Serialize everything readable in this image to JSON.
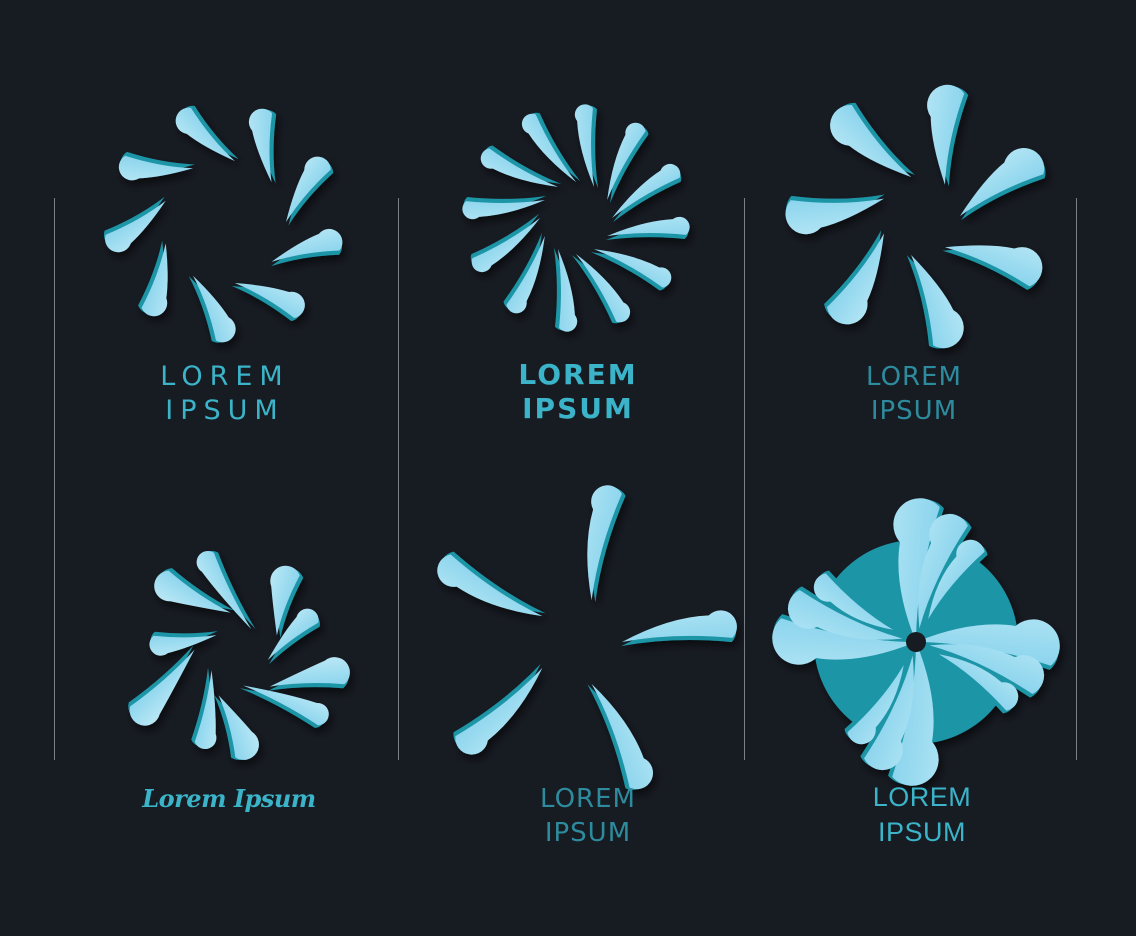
{
  "colors": {
    "background": "#171b22",
    "caption_teal": "#3bb4c9",
    "caption_muted": "#2f92a4",
    "petal_light": "#c4ecf7",
    "petal_mid": "#8fd6ee",
    "petal_dark": "#3fb0cf",
    "petal_teal": "#1e95a6"
  },
  "logos": [
    {
      "name": "swirl-logo-1",
      "style": "ring-of-drops",
      "caption_lines": [
        "LOREM",
        "IPSUM"
      ]
    },
    {
      "name": "swirl-logo-2",
      "style": "pinwheel-blades",
      "caption_lines": [
        "LOREM",
        "IPSUM"
      ]
    },
    {
      "name": "swirl-logo-3",
      "style": "thick-swirl",
      "caption_lines": [
        "LOREM",
        "IPSUM"
      ]
    },
    {
      "name": "swirl-logo-4",
      "style": "splash-drops",
      "caption_lines": [
        "Lorem Ipsum"
      ]
    },
    {
      "name": "swirl-logo-5",
      "style": "crescent-spiral",
      "caption_lines": [
        "LOREM",
        "IPSUM"
      ]
    },
    {
      "name": "swirl-logo-6",
      "style": "layered-wave-spiral",
      "caption_lines": [
        "LOREM",
        "IPSUM"
      ]
    }
  ]
}
